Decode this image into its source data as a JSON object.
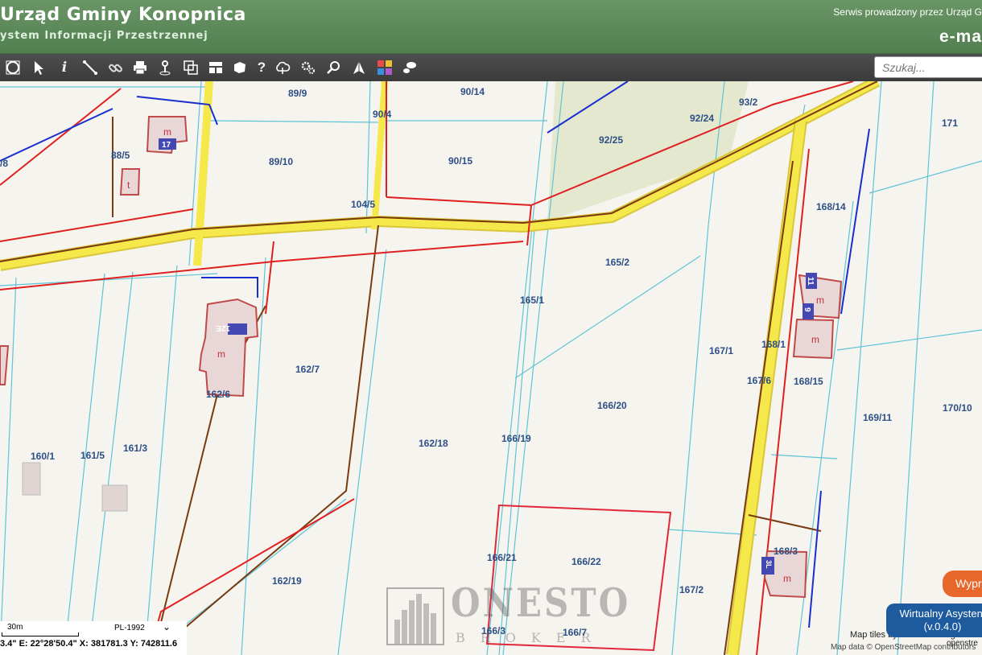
{
  "header": {
    "title": "Urząd Gminy Konopnica",
    "subtitle": "ystem Informacji Przestrzennej",
    "right_text": "Serwis prowadzony przez Urząd G",
    "brand": "e-ma"
  },
  "toolbar": {
    "icons": [
      "zoom-extent-icon",
      "pointer-icon",
      "info-icon",
      "measure-icon",
      "link-icon",
      "print-icon",
      "pin-icon",
      "layers-icon",
      "table-icon",
      "cube-icon",
      "help-icon",
      "cloud-icon",
      "settings-icon",
      "search-map-icon",
      "compass-icon",
      "color-grid-icon",
      "chat-icon"
    ]
  },
  "search": {
    "placeholder": "Szukaj..."
  },
  "parcels": [
    "89/9",
    "90/14",
    "93/2",
    "171",
    "90/4",
    "92/24",
    "88/5",
    "92/25",
    "89/10",
    "90/15",
    "168/14",
    "104/5",
    "165/2",
    "165/1",
    "167/1",
    "168/1",
    "162/7",
    "167/6",
    "168/15",
    "162/6",
    "166/20",
    "169/11",
    "170/10",
    "162/18",
    "166/19",
    "160/1",
    "161/5",
    "161/3",
    "166/21",
    "166/22",
    "168/3",
    "162/19",
    "167/2",
    "166/3",
    "166/7",
    "/8"
  ],
  "building_numbers": [
    "17",
    "12E",
    "11",
    "9",
    "3L"
  ],
  "building_marks": [
    "m",
    "t"
  ],
  "watermark": {
    "name": "ONESTO",
    "sub": "BROKER"
  },
  "scale": {
    "label": "30m",
    "crs": "PL-1992"
  },
  "coords": "3.4\" E: 22°28'50.4\"  X: 381781.3  Y: 742811.6",
  "attribution": {
    "tiles": "Map tiles by Stamen Design",
    "data": "Map data © OpenStreetMap contributors",
    "osm": "openstre"
  },
  "buttons": {
    "orange": "Wyprow",
    "assistant": "Wirtualny Asystent",
    "assistant_version": "(v.0.4.0)"
  },
  "colors": {
    "header": "#5a8a5a",
    "road": "#f5e84a",
    "parcel_line": "#5fc3d6",
    "power_line": "#e02020",
    "water_line": "#1a2ed0",
    "gas_line": "#7a3a10",
    "building": "#e9d7d7",
    "building_border": "#c04a4a"
  }
}
